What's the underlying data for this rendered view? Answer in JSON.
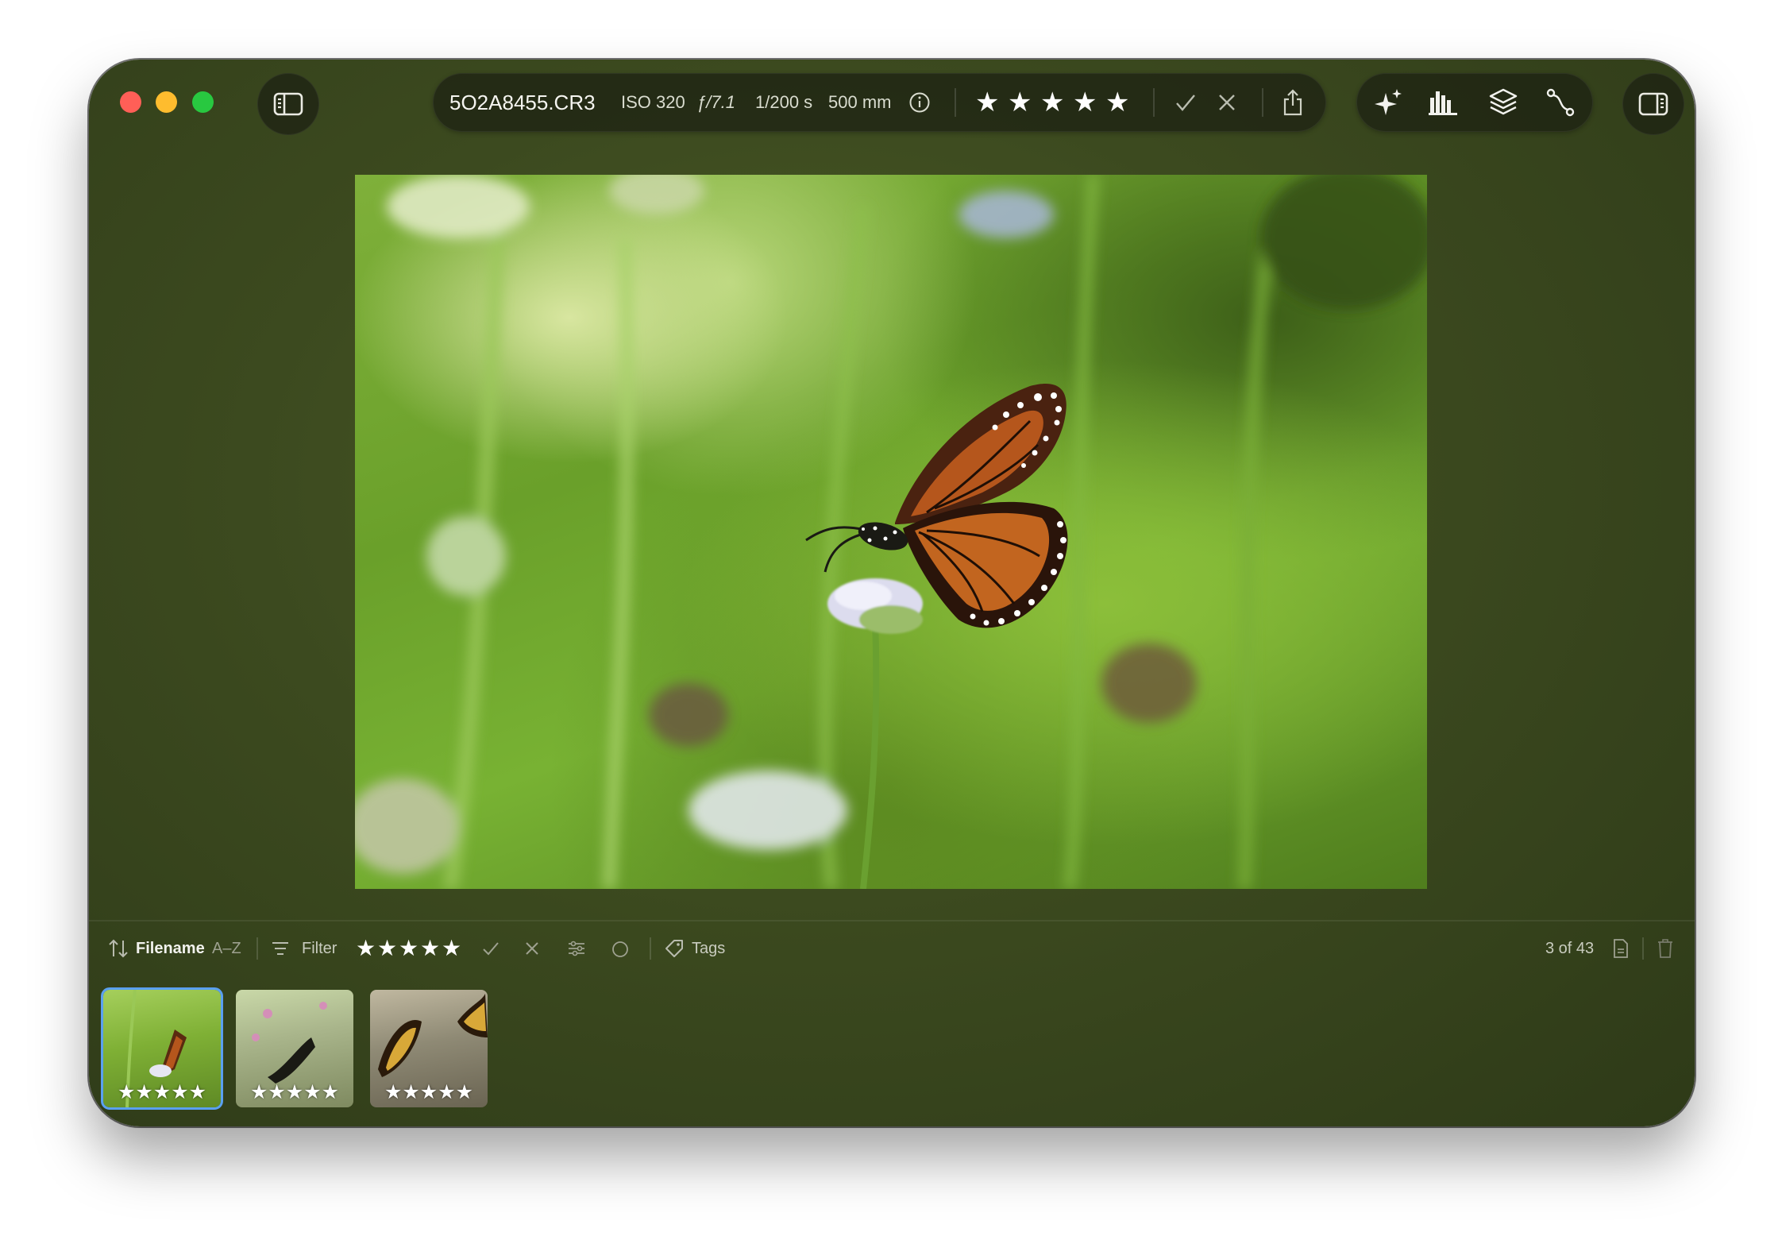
{
  "window": {
    "controls": [
      "close",
      "minimize",
      "zoom"
    ]
  },
  "info_bar": {
    "filename": "5O2A8455.CR3",
    "iso": "ISO 320",
    "aperture": "ƒ/7.1",
    "shutter": "1/200 s",
    "focal_length": "500 mm",
    "rating": 5,
    "stars": "★"
  },
  "icons": {
    "sidebar": "sidebar-left-icon",
    "info": "info-icon",
    "pick": "checkmark-icon",
    "reject": "x-icon",
    "share": "share-icon",
    "enhance": "sparkle-icon",
    "histogram": "histogram-icon",
    "layers": "layers-icon",
    "curve": "curve-icon",
    "inspector": "sidebar-right-icon"
  },
  "bottom_bar": {
    "sort_label": "Filename",
    "sort_order": "A–Z",
    "filter_label": "Filter",
    "filter_rating": 5,
    "tags_label": "Tags",
    "position": "3 of 43"
  },
  "thumbnails": [
    {
      "rating": 5,
      "selected": true
    },
    {
      "rating": 5,
      "selected": false
    },
    {
      "rating": 5,
      "selected": false
    }
  ],
  "colors": {
    "accent_selection": "#5aa0f0",
    "close": "#ff5f57",
    "minimize": "#febc2e",
    "zoom": "#28c840"
  }
}
